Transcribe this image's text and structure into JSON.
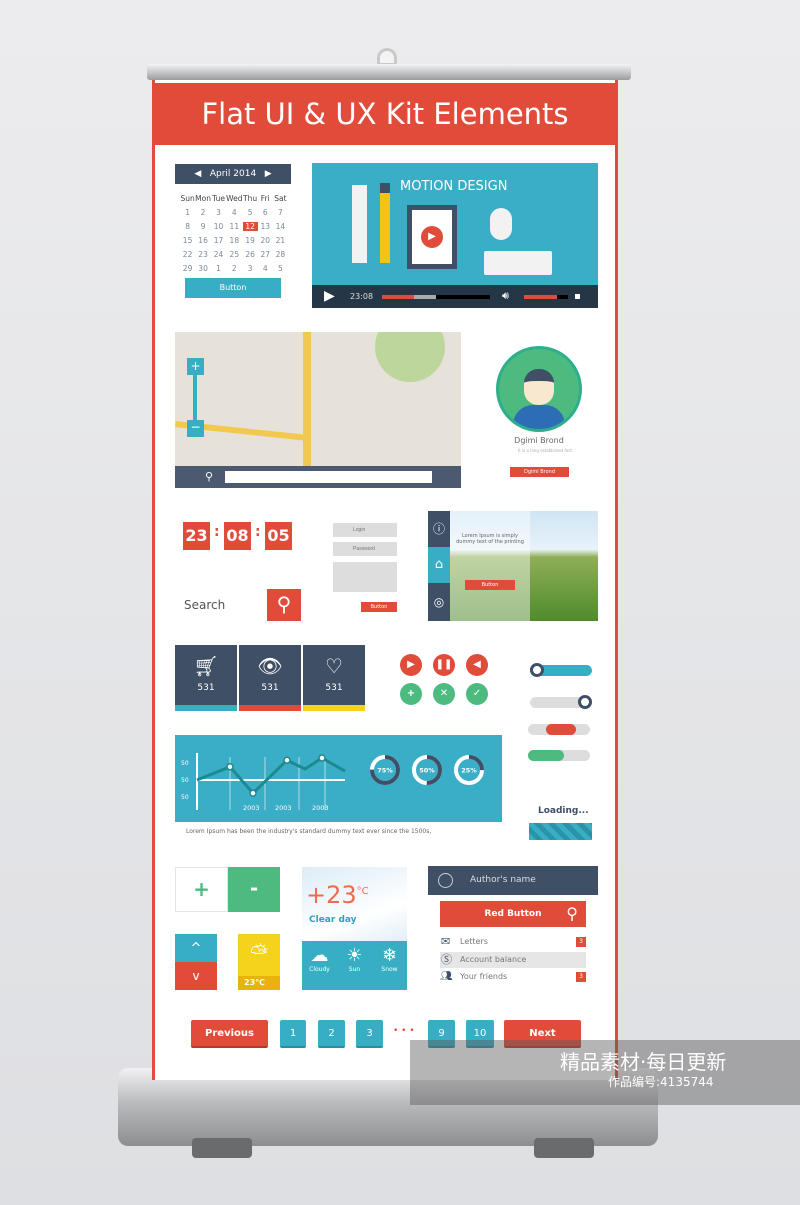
{
  "title": "Flat UI & UX Kit Elements",
  "calendar": {
    "month": "April 2014",
    "days": [
      "Sun",
      "Mon",
      "Tue",
      "Wed",
      "Thu",
      "Fri",
      "Sat"
    ],
    "dates": [
      "1",
      "2",
      "3",
      "4",
      "5",
      "6",
      "7",
      "8",
      "9",
      "10",
      "11",
      "12",
      "13",
      "14",
      "15",
      "16",
      "17",
      "18",
      "19",
      "20",
      "21",
      "22",
      "23",
      "24",
      "25",
      "26",
      "27",
      "28",
      "29",
      "30",
      "1",
      "2",
      "3",
      "4",
      "5"
    ],
    "selected": "12",
    "button": "Button"
  },
  "video": {
    "title": "MOTION DESIGN",
    "time": "23:08",
    "progress": 0.3,
    "buffered": 0.5,
    "volume": 0.75
  },
  "profile": {
    "name": "Dgimi Brond",
    "subtitle": "It is a long established fact",
    "button": "Dgimi Brond"
  },
  "timer": {
    "h": "23",
    "m": "08",
    "s": "05",
    "sep": ":"
  },
  "login": {
    "login_placeholder": "Login",
    "password_placeholder": "Password",
    "button": "Button"
  },
  "search": {
    "label": "Search"
  },
  "slider": {
    "text": "Lorem Ipsum is simply dummy text of the printing",
    "button": "Button"
  },
  "stats": [
    {
      "icon": "cart-icon",
      "value": "531",
      "color": "#37aec4"
    },
    {
      "icon": "eye-icon",
      "value": "531",
      "color": "#e04b3a"
    },
    {
      "icon": "heart-icon",
      "value": "531",
      "color": "#f5d21b"
    }
  ],
  "chart_data": {
    "type": "line",
    "y_tick_labels": [
      "50",
      "50",
      "50"
    ],
    "x_tick_labels": [
      "2003",
      "2003",
      "2003"
    ],
    "values": [
      50,
      62,
      38,
      68,
      60,
      70,
      58
    ],
    "donuts": [
      {
        "label": "75%",
        "value": 75
      },
      {
        "label": "50%",
        "value": 50
      },
      {
        "label": "25%",
        "value": 25
      }
    ]
  },
  "chart_caption": "Lorem Ipsum has been the industry's standard dummy text ever since the 1500s,",
  "loading": "Loading...",
  "stepper": {
    "plus": "+",
    "minus": "-",
    "up": "^",
    "down": "v"
  },
  "weather_small": {
    "temp": "23℃"
  },
  "weather": {
    "temp": "+23",
    "unit": "°C",
    "desc": "Clear day",
    "items": [
      "Cloudy",
      "Sun",
      "Snow"
    ]
  },
  "menu": {
    "author": "Author's name",
    "red_button": "Red Button",
    "items": [
      {
        "label": "Letters",
        "badge": "3"
      },
      {
        "label": "Account balance"
      },
      {
        "label": "Your friends",
        "badge": "3"
      }
    ]
  },
  "pagination": {
    "prev": "Previous",
    "pages": [
      "1",
      "2",
      "3"
    ],
    "dots": "• • •",
    "pages2": [
      "9",
      "10"
    ],
    "next": "Next"
  },
  "watermark": {
    "line1": "精品素材·每日更新",
    "line2": "作品编号:4135744"
  },
  "colors": {
    "red": "#e04b3a",
    "teal": "#37aec4",
    "navy": "#3f4f66",
    "green": "#4dbb7f",
    "yellow": "#f5d21b"
  }
}
